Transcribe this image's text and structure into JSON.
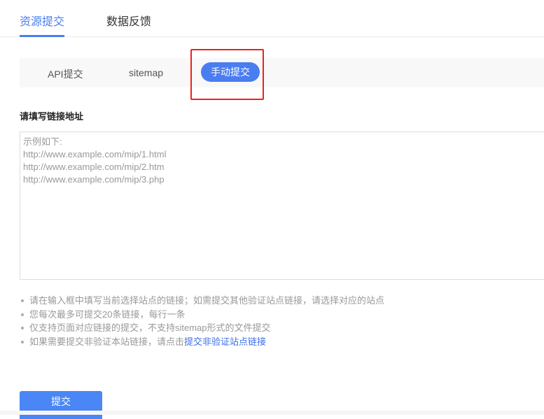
{
  "tabs": [
    {
      "label": "资源提交",
      "active": true
    },
    {
      "label": "数据反馈",
      "active": false
    }
  ],
  "subtabs": [
    {
      "label": "API提交"
    },
    {
      "label": "sitemap"
    },
    {
      "label": "手动提交",
      "active": true
    }
  ],
  "form": {
    "label": "请填写链接地址",
    "placeholder": "示例如下:\nhttp://www.example.com/mip/1.html\nhttp://www.example.com/mip/2.htm\nhttp://www.example.com/mip/3.php",
    "value": ""
  },
  "tips": [
    "请在输入框中填写当前选择站点的链接；如需提交其他验证站点链接，请选择对应的站点",
    "您每次最多可提交20条链接，每行一条",
    "仅支持页面对应链接的提交，不支持sitemap形式的文件提交",
    "如果需要提交非验证本站链接，请点击"
  ],
  "tip_link": "提交非验证站点链接",
  "submit_label": "提交",
  "colors": {
    "accent": "#4a7df0",
    "highlight": "#f0201a"
  }
}
